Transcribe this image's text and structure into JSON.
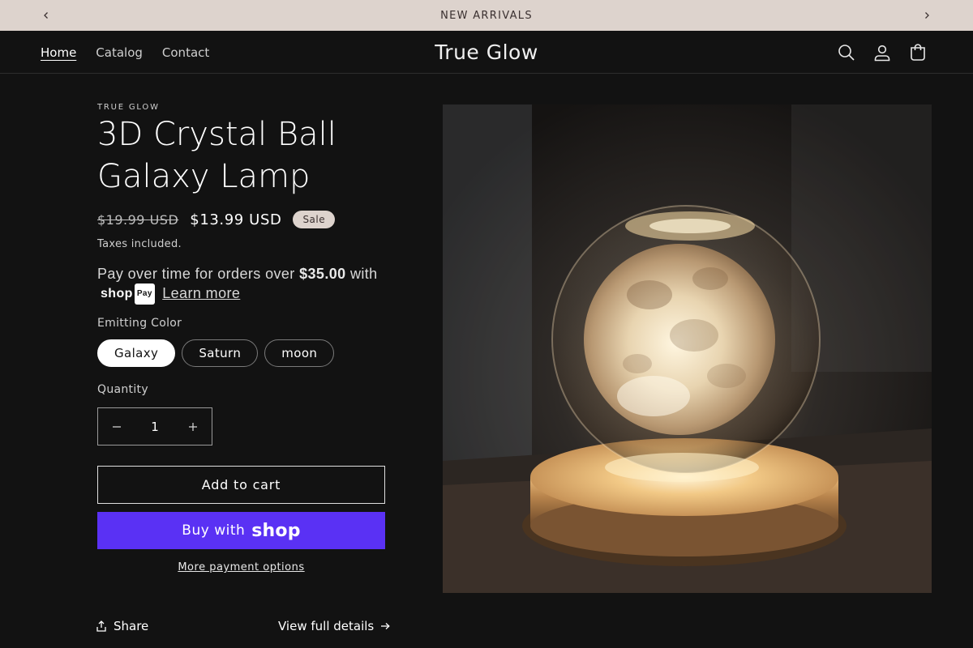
{
  "announcement": {
    "text": "NEW ARRIVALS"
  },
  "header": {
    "nav": [
      {
        "label": "Home",
        "active": true
      },
      {
        "label": "Catalog",
        "active": false
      },
      {
        "label": "Contact",
        "active": false
      }
    ],
    "logo": "True Glow",
    "icons": [
      "search-icon",
      "account-icon",
      "cart-icon"
    ]
  },
  "product": {
    "vendor": "TRUE GLOW",
    "title": "3D Crystal Ball Galaxy Lamp",
    "price_regular": "$19.99 USD",
    "price_sale": "$13.99 USD",
    "sale_badge": "Sale",
    "taxes": "Taxes included.",
    "installments": {
      "prefix": "Pay over time for orders over",
      "amount": "$35.00",
      "with": "with",
      "brand": "shop",
      "brand_pay": "Pay",
      "learn_more": "Learn more"
    },
    "option_label": "Emitting Color",
    "variants": [
      {
        "label": "Galaxy",
        "selected": true
      },
      {
        "label": "Saturn",
        "selected": false
      },
      {
        "label": "moon",
        "selected": false
      }
    ],
    "quantity_label": "Quantity",
    "quantity": "1",
    "add_to_cart": "Add to cart",
    "buy_with": "Buy with",
    "buy_brand": "shop",
    "more_payment": "More payment options",
    "share": "Share",
    "view_details": "View full details"
  },
  "colors": {
    "background": "#121212",
    "announcement_bg": "#ddd3cd",
    "shop_pay_purple": "#5a31f4"
  }
}
